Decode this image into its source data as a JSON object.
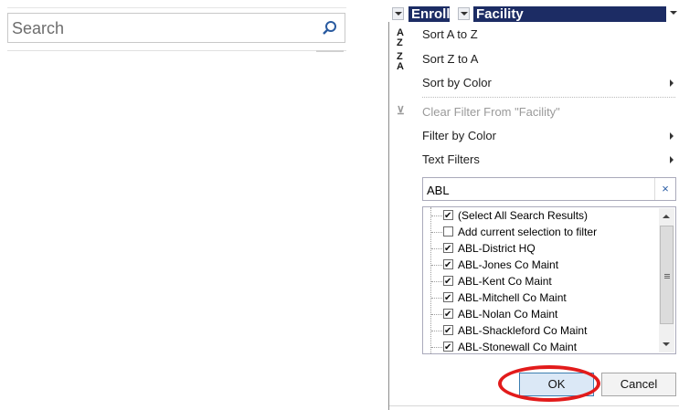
{
  "search": {
    "placeholder": "Search"
  },
  "header": {
    "col1": "Enroll",
    "col2": "Facility"
  },
  "menu": {
    "sort_az": "Sort A to Z",
    "sort_za": "Sort Z to A",
    "sort_color": "Sort by Color",
    "clear_filter": "Clear Filter From \"Facility\"",
    "filter_color": "Filter by Color",
    "text_filters": "Text Filters"
  },
  "filter": {
    "value": "ABL",
    "clear_label": "×"
  },
  "list": [
    {
      "label": "(Select All Search Results)",
      "checked": true
    },
    {
      "label": "Add current selection to filter",
      "checked": false
    },
    {
      "label": "ABL-District HQ",
      "checked": true
    },
    {
      "label": "ABL-Jones Co Maint",
      "checked": true
    },
    {
      "label": "ABL-Kent Co Maint",
      "checked": true
    },
    {
      "label": "ABL-Mitchell Co Maint",
      "checked": true
    },
    {
      "label": "ABL-Nolan Co Maint",
      "checked": true
    },
    {
      "label": "ABL-Shackleford Co Maint",
      "checked": true
    },
    {
      "label": "ABL-Stonewall Co Maint",
      "checked": true
    }
  ],
  "buttons": {
    "ok": "OK",
    "cancel": "Cancel"
  },
  "colors": {
    "header_bg": "#1c2c64",
    "highlight": "#e21b1b"
  },
  "icons": {
    "search": "search-icon",
    "sort_az": "sort-az-icon",
    "sort_za": "sort-za-icon",
    "clear_filter": "clear-filter-icon"
  }
}
